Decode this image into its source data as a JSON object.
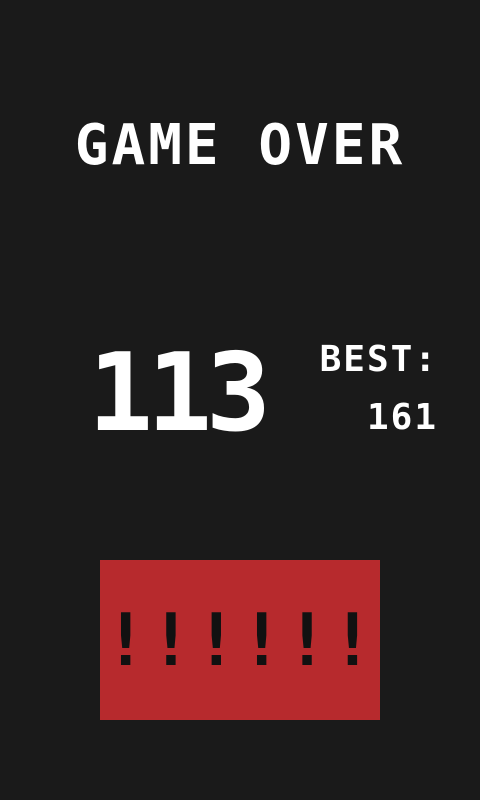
{
  "game": {
    "title": "GAME OVER",
    "score": "113",
    "best_label": "BEST:",
    "best_value": "161",
    "action_button": {
      "label": "!!!!!!",
      "color": "#b72a2d",
      "text_color": "#111111"
    }
  },
  "colors": {
    "background": "#1a1a1a",
    "text": "#ffffff"
  }
}
